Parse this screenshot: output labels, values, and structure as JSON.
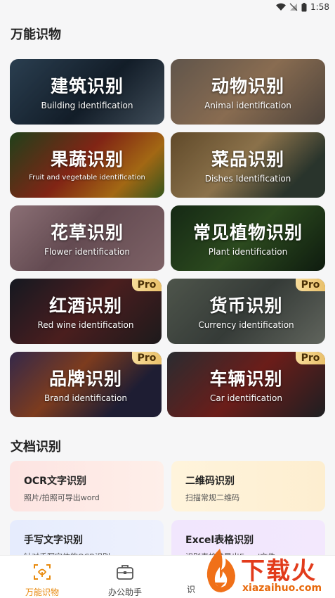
{
  "status": {
    "time": "1:58"
  },
  "sections": {
    "things": "万能识物",
    "docs": "文档识别"
  },
  "cards": [
    {
      "cn": "建筑识别",
      "en": "Building identification",
      "pro": false,
      "bg": "linear-gradient(135deg,#3d5a73,#1b2a3a 55%,#5c6f80)"
    },
    {
      "cn": "动物识别",
      "en": "Animal identification",
      "pro": false,
      "bg": "linear-gradient(135deg,#8a7a6c,#c49b74 50%,#6f6156)"
    },
    {
      "cn": "果蔬识别",
      "en": "Fruit and vegetable identification",
      "pro": false,
      "bg": "linear-gradient(135deg,#2e5d26,#b9351f 45%,#e9951d 75%,#4c7a2a)"
    },
    {
      "cn": "菜品识别",
      "en": "Dishes Identification",
      "pro": false,
      "bg": "linear-gradient(135deg,#8a6a3d,#c7a36b 45%,#3b4b3f 80%)"
    },
    {
      "cn": "花草识别",
      "en": "Flower identification",
      "pro": false,
      "bg": "linear-gradient(135deg,#c7a0a8,#8f6b75 45%,#b58e94)"
    },
    {
      "cn": "常见植物识别",
      "en": "Plant identification",
      "pro": false,
      "bg": "linear-gradient(135deg,#1f3b1e,#3f6a2c 50%,#152816)"
    },
    {
      "cn": "红酒识别",
      "en": "Red wine identification",
      "pro": true,
      "bg": "linear-gradient(135deg,#1e2430,#6b2b2c 50%,#2a2628)"
    },
    {
      "cn": "货币识别",
      "en": "Currency identification",
      "pro": true,
      "bg": "linear-gradient(135deg,#707a6c,#4d5550 50%,#8a9085)"
    },
    {
      "cn": "品牌识别",
      "en": "Brand identification",
      "pro": true,
      "bg": "linear-gradient(135deg,#4a3a6a,#b3562c 40%,#2b2a4a 75%)"
    },
    {
      "cn": "车辆识别",
      "en": "Car identification",
      "pro": true,
      "bg": "linear-gradient(135deg,#3c4046,#9a2a25 50%,#2b2d31)"
    }
  ],
  "pro_label": "Pro",
  "docs": [
    {
      "title": "OCR文字识别",
      "sub": "照片/拍照可导出word",
      "bg": "linear-gradient(90deg,#fde4e2,#feefe9)"
    },
    {
      "title": "二维码识别",
      "sub": "扫描常规二维码",
      "bg": "linear-gradient(90deg,#fff4dc,#fdeed0)"
    },
    {
      "title": "手写文字识别",
      "sub": "针对手写字体的OCR识别",
      "bg": "linear-gradient(90deg,#e6ecfd,#eef1fd)"
    },
    {
      "title": "Excel表格识别",
      "sub": "识别表格并导出Excel文件",
      "bg": "linear-gradient(90deg,#f1e6fd,#f3e8fd)"
    }
  ],
  "tabs": [
    {
      "label": "万能识物",
      "active": true
    },
    {
      "label": "办公助手",
      "active": false
    },
    {
      "label": "识",
      "active": false
    }
  ],
  "watermark": {
    "text": "下载火",
    "sub": "xiazaihuo.com"
  },
  "colors": {
    "accent": "#e8890c",
    "pro_text": "#4a2f06"
  }
}
